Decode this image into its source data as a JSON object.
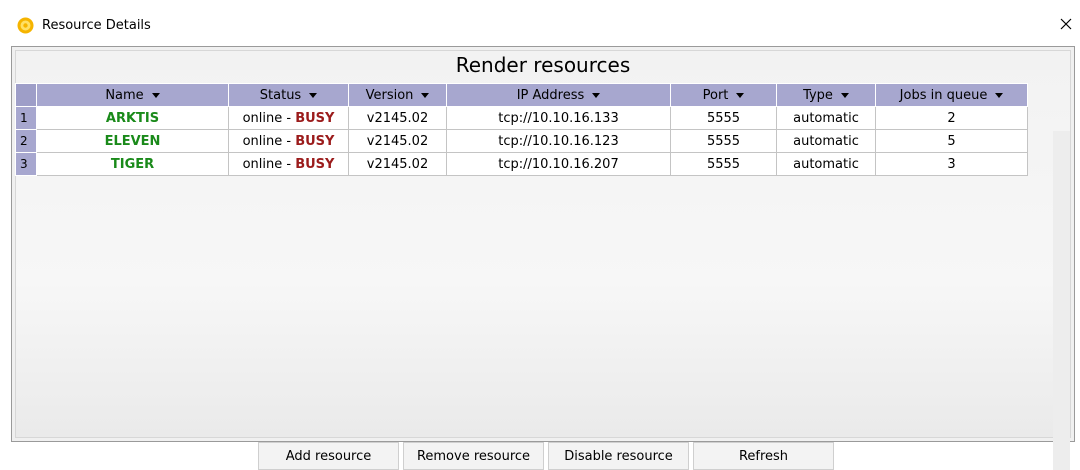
{
  "window": {
    "title": "Resource Details",
    "close_glyph": "×"
  },
  "panel": {
    "title": "Render resources"
  },
  "table": {
    "columns": [
      "Name",
      "Status",
      "Version",
      "IP Address",
      "Port",
      "Type",
      "Jobs in queue"
    ],
    "rows": [
      {
        "num": "1",
        "name": "ARKTIS",
        "status_prefix": "online -",
        "status_flag": "BUSY",
        "version": "v2145.02",
        "ip": "tcp://10.10.16.133",
        "port": "5555",
        "type": "automatic",
        "jobs": "2"
      },
      {
        "num": "2",
        "name": "ELEVEN",
        "status_prefix": "online -",
        "status_flag": "BUSY",
        "version": "v2145.02",
        "ip": "tcp://10.10.16.123",
        "port": "5555",
        "type": "automatic",
        "jobs": "5"
      },
      {
        "num": "3",
        "name": "TIGER",
        "status_prefix": "online -",
        "status_flag": "BUSY",
        "version": "v2145.02",
        "ip": "tcp://10.10.16.207",
        "port": "5555",
        "type": "automatic",
        "jobs": "3"
      }
    ]
  },
  "buttons": {
    "add": "Add resource",
    "remove": "Remove resource",
    "disable": "Disable resource",
    "refresh": "Refresh"
  },
  "colors": {
    "header_bg": "#a7a7cf",
    "name_text": "#1a8a1a",
    "busy_text": "#9b1b1b"
  },
  "icons": {
    "app": "app-logo-icon",
    "close": "close-icon",
    "sort": "chevron-down-icon"
  }
}
